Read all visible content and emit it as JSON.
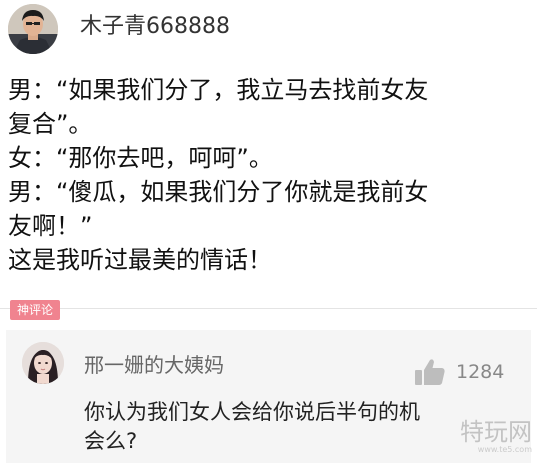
{
  "post": {
    "author": "木子青668888",
    "lines": [
      "男：“如果我们分了，我立马去找前女友",
      "复合”。",
      "女：“那你去吧，呵呵”。",
      "男：“傻瓜，如果我们分了你就是我前女",
      "友啊！”",
      "这是我听过最美的情话！"
    ]
  },
  "hot_comments": {
    "tag": "神评论",
    "comment": {
      "author": "邢一姗的大姨妈",
      "like_icon": "thumbs-up-icon",
      "likes": "1284",
      "lines": [
        "你认为我们女人会给你说后半句的机",
        "会么?"
      ]
    }
  },
  "watermark": {
    "text": "特玩网",
    "url": "www.te5.com"
  },
  "colors": {
    "tag_background": "#f0838f",
    "comment_background": "#f5f5f5",
    "username": "#333333",
    "like_icon": "#bdbdbd"
  }
}
